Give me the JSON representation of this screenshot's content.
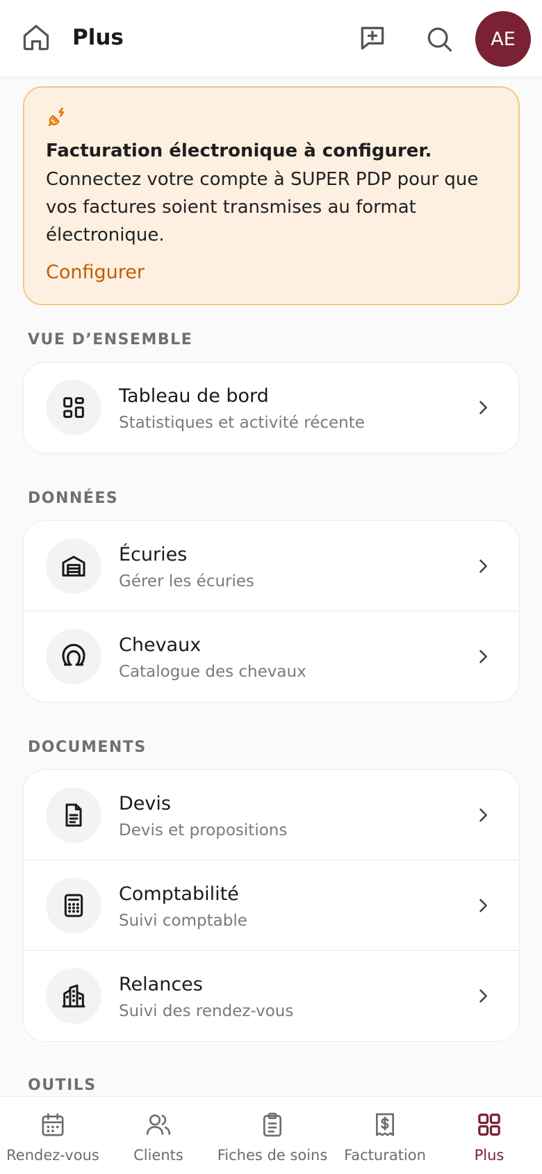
{
  "header": {
    "title": "Plus",
    "avatar_initials": "AE",
    "avatar_color": "#7a2233",
    "icons": [
      "home-icon",
      "message-plus-icon",
      "search-icon"
    ]
  },
  "banner": {
    "title": "Facturation électronique à configurer.",
    "body": "Connectez votre compte à SUPER PDP pour que vos factures soient transmises au format électronique.",
    "link": "Configurer",
    "accent": "#c45c00",
    "background": "#fdf0e1",
    "border": "#f3c980"
  },
  "sections": [
    {
      "title": "VUE D’ENSEMBLE",
      "items": [
        {
          "title": "Tableau de bord",
          "subtitle": "Statistiques et activité récente",
          "icon": "dashboard-icon"
        }
      ]
    },
    {
      "title": "DONNÉES",
      "items": [
        {
          "title": "Écuries",
          "subtitle": "Gérer les écuries",
          "icon": "stable-icon"
        },
        {
          "title": "Chevaux",
          "subtitle": "Catalogue des chevaux",
          "icon": "horseshoe-icon"
        }
      ]
    },
    {
      "title": "DOCUMENTS",
      "items": [
        {
          "title": "Devis",
          "subtitle": "Devis et propositions",
          "icon": "document-icon"
        },
        {
          "title": "Comptabilité",
          "subtitle": "Suivi comptable",
          "icon": "calculator-icon"
        },
        {
          "title": "Relances",
          "subtitle": "Suivi des rendez-vous",
          "icon": "building-icon"
        }
      ]
    },
    {
      "title": "OUTILS",
      "items": []
    }
  ],
  "bottom_nav": {
    "items": [
      {
        "label": "Rendez-vous",
        "icon": "calendar-icon"
      },
      {
        "label": "Clients",
        "icon": "users-icon"
      },
      {
        "label": "Fiches de soins",
        "icon": "clipboard-icon"
      },
      {
        "label": "Facturation",
        "icon": "invoice-icon"
      },
      {
        "label": "Plus",
        "icon": "grid-icon",
        "active": true
      }
    ],
    "active_color": "#7a2233"
  }
}
